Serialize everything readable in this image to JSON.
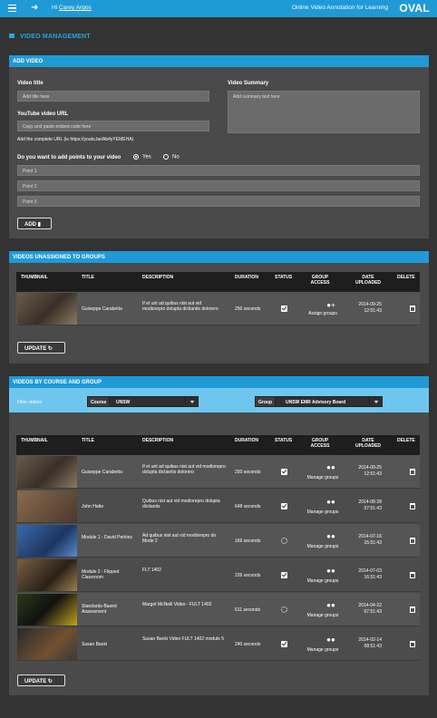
{
  "topbar": {
    "greeting_prefix": "Hi",
    "user_name": "Carey Argos",
    "app_name": "Online Video Annotation for Learning",
    "logo": "OVAL",
    "exit_icon": "sign-out-icon",
    "menu_icon": "hamburger-icon"
  },
  "page_title": "VIDEO MANAGEMENT",
  "add_video": {
    "header": "ADD VIDEO",
    "video_title_label": "Video title",
    "video_title_placeholder": "Add title here",
    "youtube_label": "YouTube video URL",
    "youtube_placeholder": "Copy and paste embed code here",
    "youtube_help": "Add the complete URL  (ie https://youtu.be/Ab4yYEMEHA)",
    "summary_label": "Video Summary",
    "summary_placeholder": "Add summary text here",
    "points_question": "Do you want to add points to your video",
    "radio_yes": "Yes",
    "radio_no": "No",
    "points": [
      "Point 1",
      "Point 2",
      "Point 3"
    ],
    "add_button": "ADD"
  },
  "unassigned": {
    "header": "VIDEOS UNASSIGNED TO GROUPS",
    "columns": [
      "THUMBNAIL",
      "TITLE",
      "DESCRIPTION",
      "DURATION",
      "STATUS",
      "GROUP ACCESS",
      "DATE UPLOADED",
      "DELETE"
    ],
    "rows": [
      {
        "title": "Guiseppe Carabetta",
        "description": "If et unt ad quibus nist aut vid modiorepro dolupta dictiantis dolorero",
        "duration": "250 seconds",
        "status": "done",
        "group": "Assign groups",
        "date": "2014-09-25",
        "time": "12:51:43"
      }
    ],
    "update_button": "UPDATE"
  },
  "by_course": {
    "header": "VIDEOS BY COURSE AND GROUP",
    "filter_label": "Filter videos",
    "course_label": "Course",
    "course_value": "UNSW",
    "group_label": "Group",
    "group_value": "UNSW EMR Advisory Board",
    "columns": [
      "THUMBNAIL",
      "TITLE",
      "DESCRIPTION",
      "DURATION",
      "STATUS",
      "GROUP ACCESS",
      "DATE UPLOADED",
      "DELETE"
    ],
    "rows": [
      {
        "title": "Guiseppe Carabetta",
        "description": "If et unt ad quibus nist aut vid modiorepro dolupta dictiantis dolorero",
        "duration": "250 seconds",
        "status": "done",
        "group": "Manage groups",
        "date": "2014-09-25",
        "time": "12:51:43"
      },
      {
        "title": "John Hatte",
        "description": "Quibus nist aut vid modiorepro dolupta dictiantis",
        "duration": "648 seconds",
        "status": "done",
        "group": "Manage groups",
        "date": "2014-08-28",
        "time": "07:51:43"
      },
      {
        "title": "Module 1 - David Perkins",
        "description": "Ad quibus nist aut vid modiorepro do Mode 2",
        "duration": "169 seconds",
        "status": "processing",
        "group": "Manage groups",
        "date": "2014-07-16",
        "time": "15:51:43"
      },
      {
        "title": "Module 2 - Flipped Classroom",
        "description": "FLT 1402",
        "duration": "226 seconds",
        "status": "done",
        "group": "Manage groups",
        "date": "2014-07-03",
        "time": "16:51:43"
      },
      {
        "title": "Standards-Based Assessment",
        "description": "Margot McNeill Video - FULT 1402",
        "duration": "611 seconds",
        "status": "processing",
        "group": "Manage groups",
        "date": "2014-04-22",
        "time": "07:51:43"
      },
      {
        "title": "Susan Banki",
        "description": "Susan Banki Video FULT 1402 module 5",
        "duration": "240 seconds",
        "status": "done",
        "group": "Manage groups",
        "date": "2014-02-14",
        "time": "08:51:43"
      }
    ],
    "update_button": "UPDATE"
  }
}
